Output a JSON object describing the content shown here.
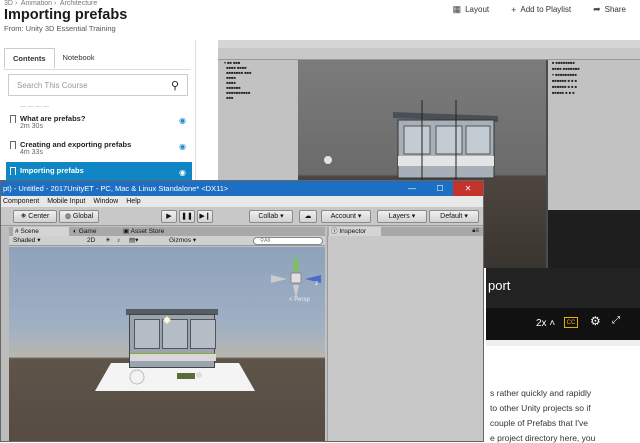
{
  "breadcrumb": [
    "3D",
    "Animation",
    "Architecture"
  ],
  "course": {
    "title": "Importing prefabs",
    "from": "From: Unity 3D Essential Training"
  },
  "header_actions": [
    {
      "label": "Layout",
      "icon": "layout-icon"
    },
    {
      "label": "Add to Playlist",
      "icon": "plus-icon"
    },
    {
      "label": "Share",
      "icon": "share-icon"
    }
  ],
  "sidebar": {
    "tabs": [
      "Contents",
      "Notebook"
    ],
    "active_tab": "Contents",
    "search_placeholder": "Search This Course",
    "items": [
      {
        "title": "What are prefabs?",
        "duration": "2m 30s",
        "active": false
      },
      {
        "title": "Creating and exporting prefabs",
        "duration": "4m 33s",
        "active": false
      },
      {
        "title": "Importing prefabs",
        "duration": "",
        "active": true
      }
    ]
  },
  "video": {
    "title_fragment": "port",
    "speed": "2x",
    "cc_label": "CC"
  },
  "transcript": {
    "lines": [
      "s rather quickly and rapidly",
      "to other Unity projects so if",
      "couple of Prefabs that I've",
      "e project directory here, you"
    ]
  },
  "unity": {
    "window_title": "pt) - Untitled - 2017UnityET - PC, Mac & Linux Standalone* <DX11>",
    "menu": [
      "Component",
      "Mobile Input",
      "Window",
      "Help"
    ],
    "toolbar": {
      "center": "Center",
      "global": "Global",
      "collab": "Collab",
      "account": "Account",
      "layers": "Layers",
      "layout": "Default"
    },
    "scene_tabs": [
      "Scene",
      "Game",
      "Asset Store"
    ],
    "scene_bar": {
      "shading": "Shaded",
      "mode_2d": "2D",
      "gizmos": "Gizmos",
      "search_placeholder": "All"
    },
    "inspector_tab": "Inspector",
    "persp_label": "< Persp"
  }
}
